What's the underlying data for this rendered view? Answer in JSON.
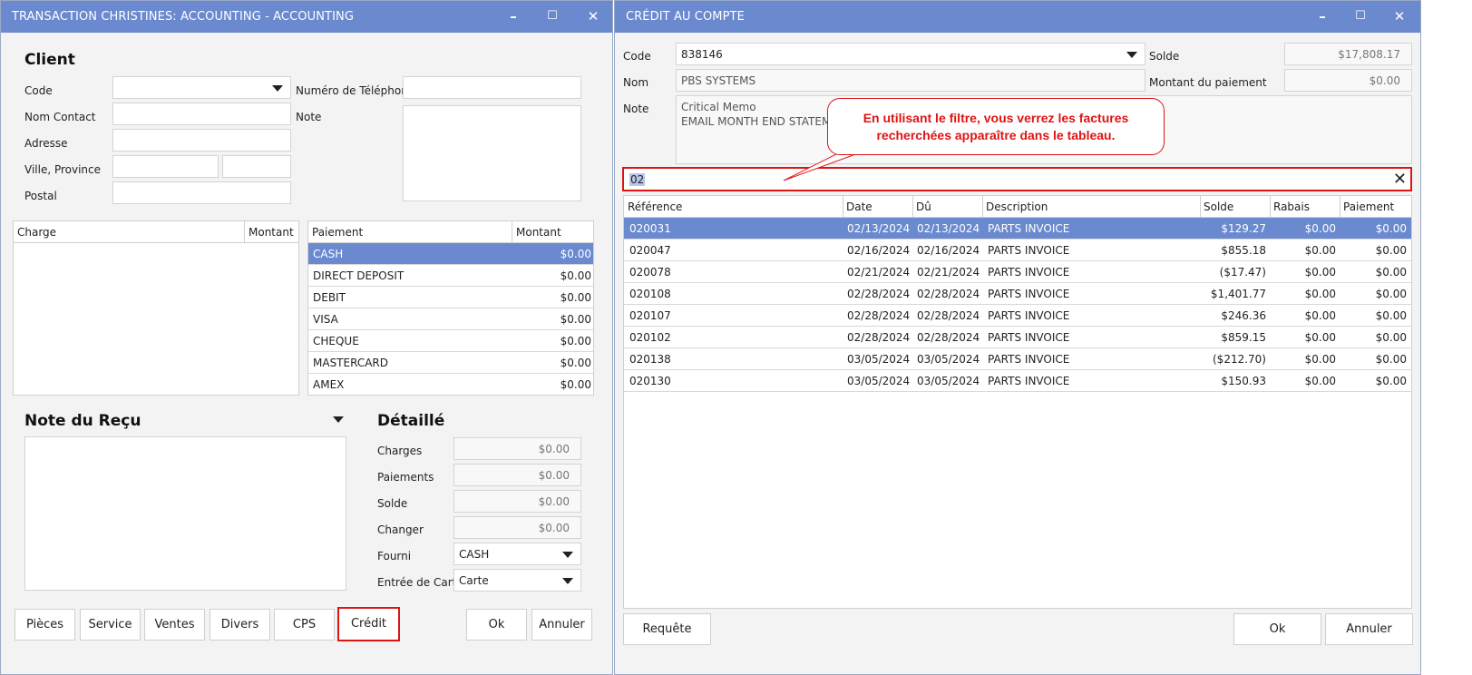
{
  "left_window": {
    "title": "TRANSACTION CHRISTINES: ACCOUNTING - ACCOUNTING",
    "controls": {
      "minimize": "–",
      "maximize": "☐",
      "close": "✕"
    },
    "client_heading": "Client",
    "labels": {
      "code": "Code",
      "contact": "Nom Contact",
      "address": "Adresse",
      "city": "Ville, Province",
      "postal": "Postal",
      "phone": "Numéro de Téléphone",
      "note": "Note"
    },
    "charge_grid": {
      "headers": [
        "Charge",
        "Montant"
      ]
    },
    "payment_grid": {
      "headers": [
        "Paiement",
        "Montant"
      ],
      "rows": [
        {
          "name": "CASH",
          "amount": "$0.00"
        },
        {
          "name": "DIRECT DEPOSIT",
          "amount": "$0.00"
        },
        {
          "name": "DEBIT",
          "amount": "$0.00"
        },
        {
          "name": "VISA",
          "amount": "$0.00"
        },
        {
          "name": "CHEQUE",
          "amount": "$0.00"
        },
        {
          "name": "MASTERCARD",
          "amount": "$0.00"
        },
        {
          "name": "AMEX",
          "amount": "$0.00"
        }
      ]
    },
    "receipt_note_heading": "Note du Reçu",
    "detail": {
      "heading": "Détaillé",
      "charges_label": "Charges",
      "charges_value": "$0.00",
      "payments_label": "Paiements",
      "payments_value": "$0.00",
      "balance_label": "Solde",
      "balance_value": "$0.00",
      "change_label": "Changer",
      "change_value": "$0.00",
      "supplied_label": "Fourni",
      "supplied_value": "CASH",
      "card_label": "Entrée de Carte",
      "card_value": "Carte"
    },
    "buttons": {
      "parts": "Pièces",
      "service": "Service",
      "sales": "Ventes",
      "misc": "Divers",
      "cps": "CPS",
      "credit": "Crédit",
      "ok": "Ok",
      "cancel": "Annuler"
    }
  },
  "right_window": {
    "title": "CRÉDIT AU COMPTE",
    "controls": {
      "minimize": "–",
      "maximize": "☐",
      "close": "✕"
    },
    "labels": {
      "code": "Code",
      "name": "Nom",
      "note": "Note",
      "balance": "Solde",
      "payment_amount": "Montant du paiement"
    },
    "code_value": "838146",
    "name_value": "PBS SYSTEMS",
    "note_lines": [
      "Critical Memo",
      "EMAIL MONTH END STATEM"
    ],
    "balance_value": "$17,808.17",
    "payment_amount_value": "$0.00",
    "filter_value": "02",
    "clear_icon": "✕",
    "callout_lines": [
      "En utilisant le filtre, vous verrez les factures",
      "recherchées apparaître dans le tableau."
    ],
    "table": {
      "headers": [
        "Référence",
        "Date",
        "Dû",
        "Description",
        "Solde",
        "Rabais",
        "Paiement"
      ],
      "rows": [
        {
          "ref": "020031",
          "date": "02/13/2024",
          "due": "02/13/2024",
          "desc": "PARTS INVOICE",
          "balance": "$129.27",
          "discount": "$0.00",
          "payment": "$0.00"
        },
        {
          "ref": "020047",
          "date": "02/16/2024",
          "due": "02/16/2024",
          "desc": "PARTS INVOICE",
          "balance": "$855.18",
          "discount": "$0.00",
          "payment": "$0.00"
        },
        {
          "ref": "020078",
          "date": "02/21/2024",
          "due": "02/21/2024",
          "desc": "PARTS INVOICE",
          "balance": "($17.47)",
          "discount": "$0.00",
          "payment": "$0.00"
        },
        {
          "ref": "020108",
          "date": "02/28/2024",
          "due": "02/28/2024",
          "desc": "PARTS INVOICE",
          "balance": "$1,401.77",
          "discount": "$0.00",
          "payment": "$0.00"
        },
        {
          "ref": "020107",
          "date": "02/28/2024",
          "due": "02/28/2024",
          "desc": "PARTS INVOICE",
          "balance": "$246.36",
          "discount": "$0.00",
          "payment": "$0.00"
        },
        {
          "ref": "020102",
          "date": "02/28/2024",
          "due": "02/28/2024",
          "desc": "PARTS INVOICE",
          "balance": "$859.15",
          "discount": "$0.00",
          "payment": "$0.00"
        },
        {
          "ref": "020138",
          "date": "03/05/2024",
          "due": "03/05/2024",
          "desc": "PARTS INVOICE",
          "balance": "($212.70)",
          "discount": "$0.00",
          "payment": "$0.00"
        },
        {
          "ref": "020130",
          "date": "03/05/2024",
          "due": "03/05/2024",
          "desc": "PARTS INVOICE",
          "balance": "$150.93",
          "discount": "$0.00",
          "payment": "$0.00"
        }
      ]
    },
    "buttons": {
      "query": "Requête",
      "ok": "Ok",
      "cancel": "Annuler"
    }
  },
  "colors": {
    "titlebar": "#6a89cf",
    "selection": "#6a89cf",
    "highlight": "#e01313",
    "callout_text": "#e01313"
  }
}
